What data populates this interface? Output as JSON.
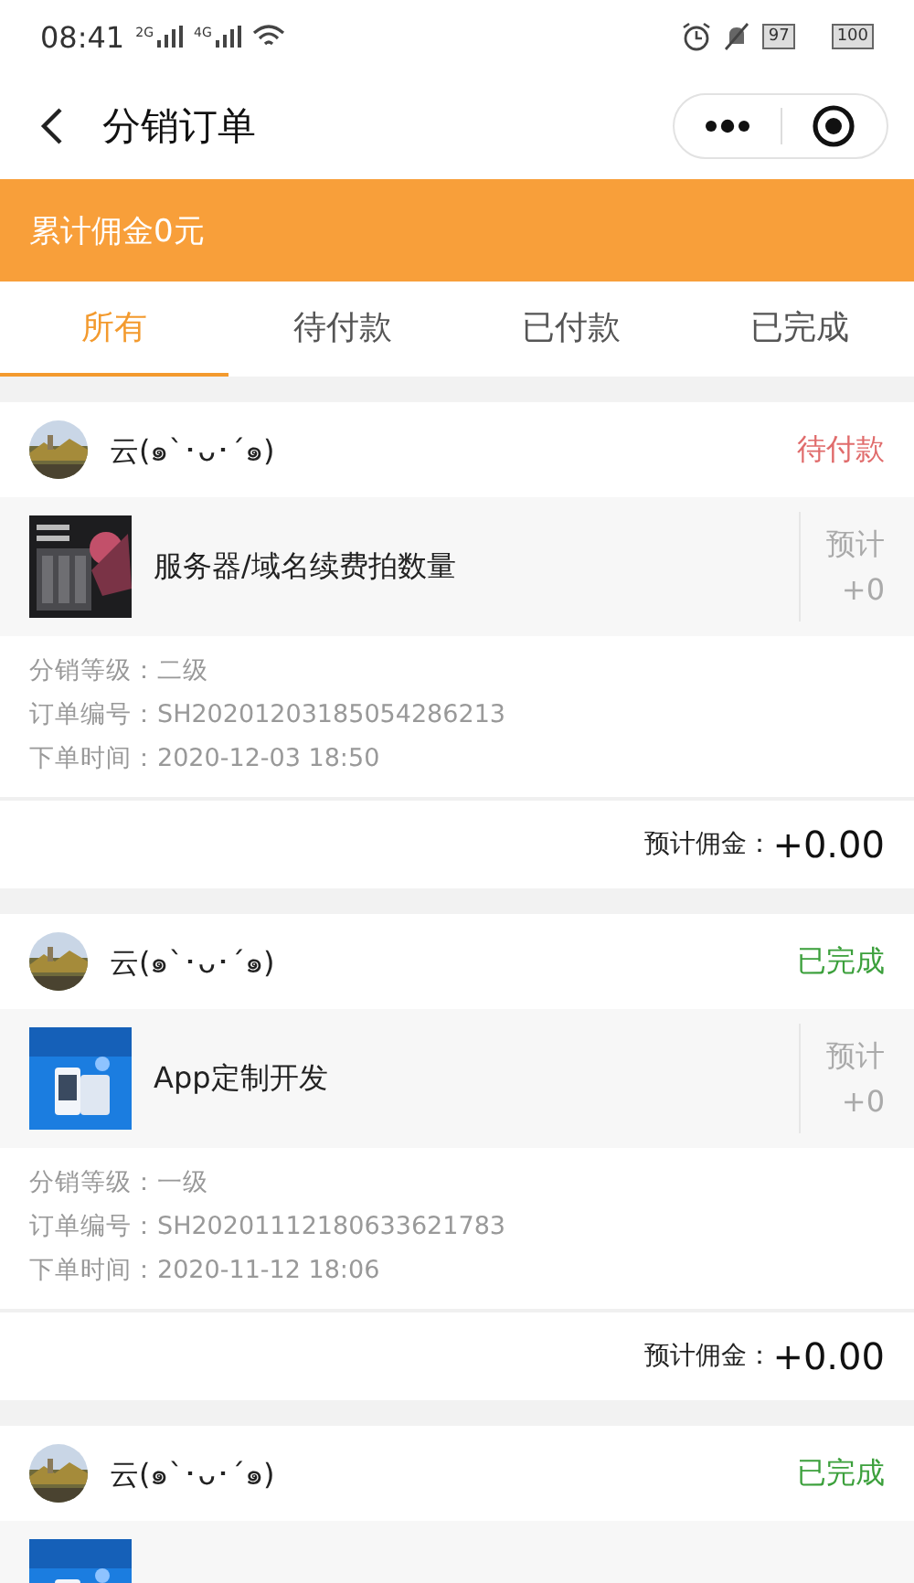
{
  "status_bar": {
    "time": "08:41",
    "signal_1": "2G",
    "signal_2": "4G",
    "battery_1": "97",
    "battery_2": "100"
  },
  "nav": {
    "title": "分销订单"
  },
  "banner": {
    "text": "累计佣金0元"
  },
  "tabs": [
    {
      "label": "所有",
      "selected": true
    },
    {
      "label": "待付款",
      "selected": false
    },
    {
      "label": "已付款",
      "selected": false
    },
    {
      "label": "已完成",
      "selected": false
    }
  ],
  "orders": [
    {
      "user": "云(๑`･ᴗ･´๑)",
      "status": "待付款",
      "color": "#e06c6c",
      "product": {
        "kind": "picture",
        "name": "服务器/域名续费拍数量",
        "estimate_label": "预计",
        "estimate": "+0"
      },
      "level": "分销等级：二级",
      "order_no": "订单编号：SH20201203185054286213",
      "time": "下单时间：2020-12-03 18:50",
      "commission_label": "预计佣金：",
      "commission": "+0.00"
    },
    {
      "user": "云(๑`･ᴗ･´๑)",
      "status": "已完成",
      "color": "#3ca03c",
      "product": {
        "kind": "picture",
        "name": "App定制开发",
        "estimate_label": "预计",
        "estimate": "+0"
      },
      "level": "分销等级：一级",
      "order_no": "订单编号：SH20201112180633621783",
      "time": "下单时间：2020-11-12 18:06",
      "commission_label": "预计佣金：",
      "commission": "+0.00"
    },
    {
      "user": "云(๑`･ᴗ･´๑)",
      "status": "已完成",
      "color": "#3ca03c"
    }
  ]
}
